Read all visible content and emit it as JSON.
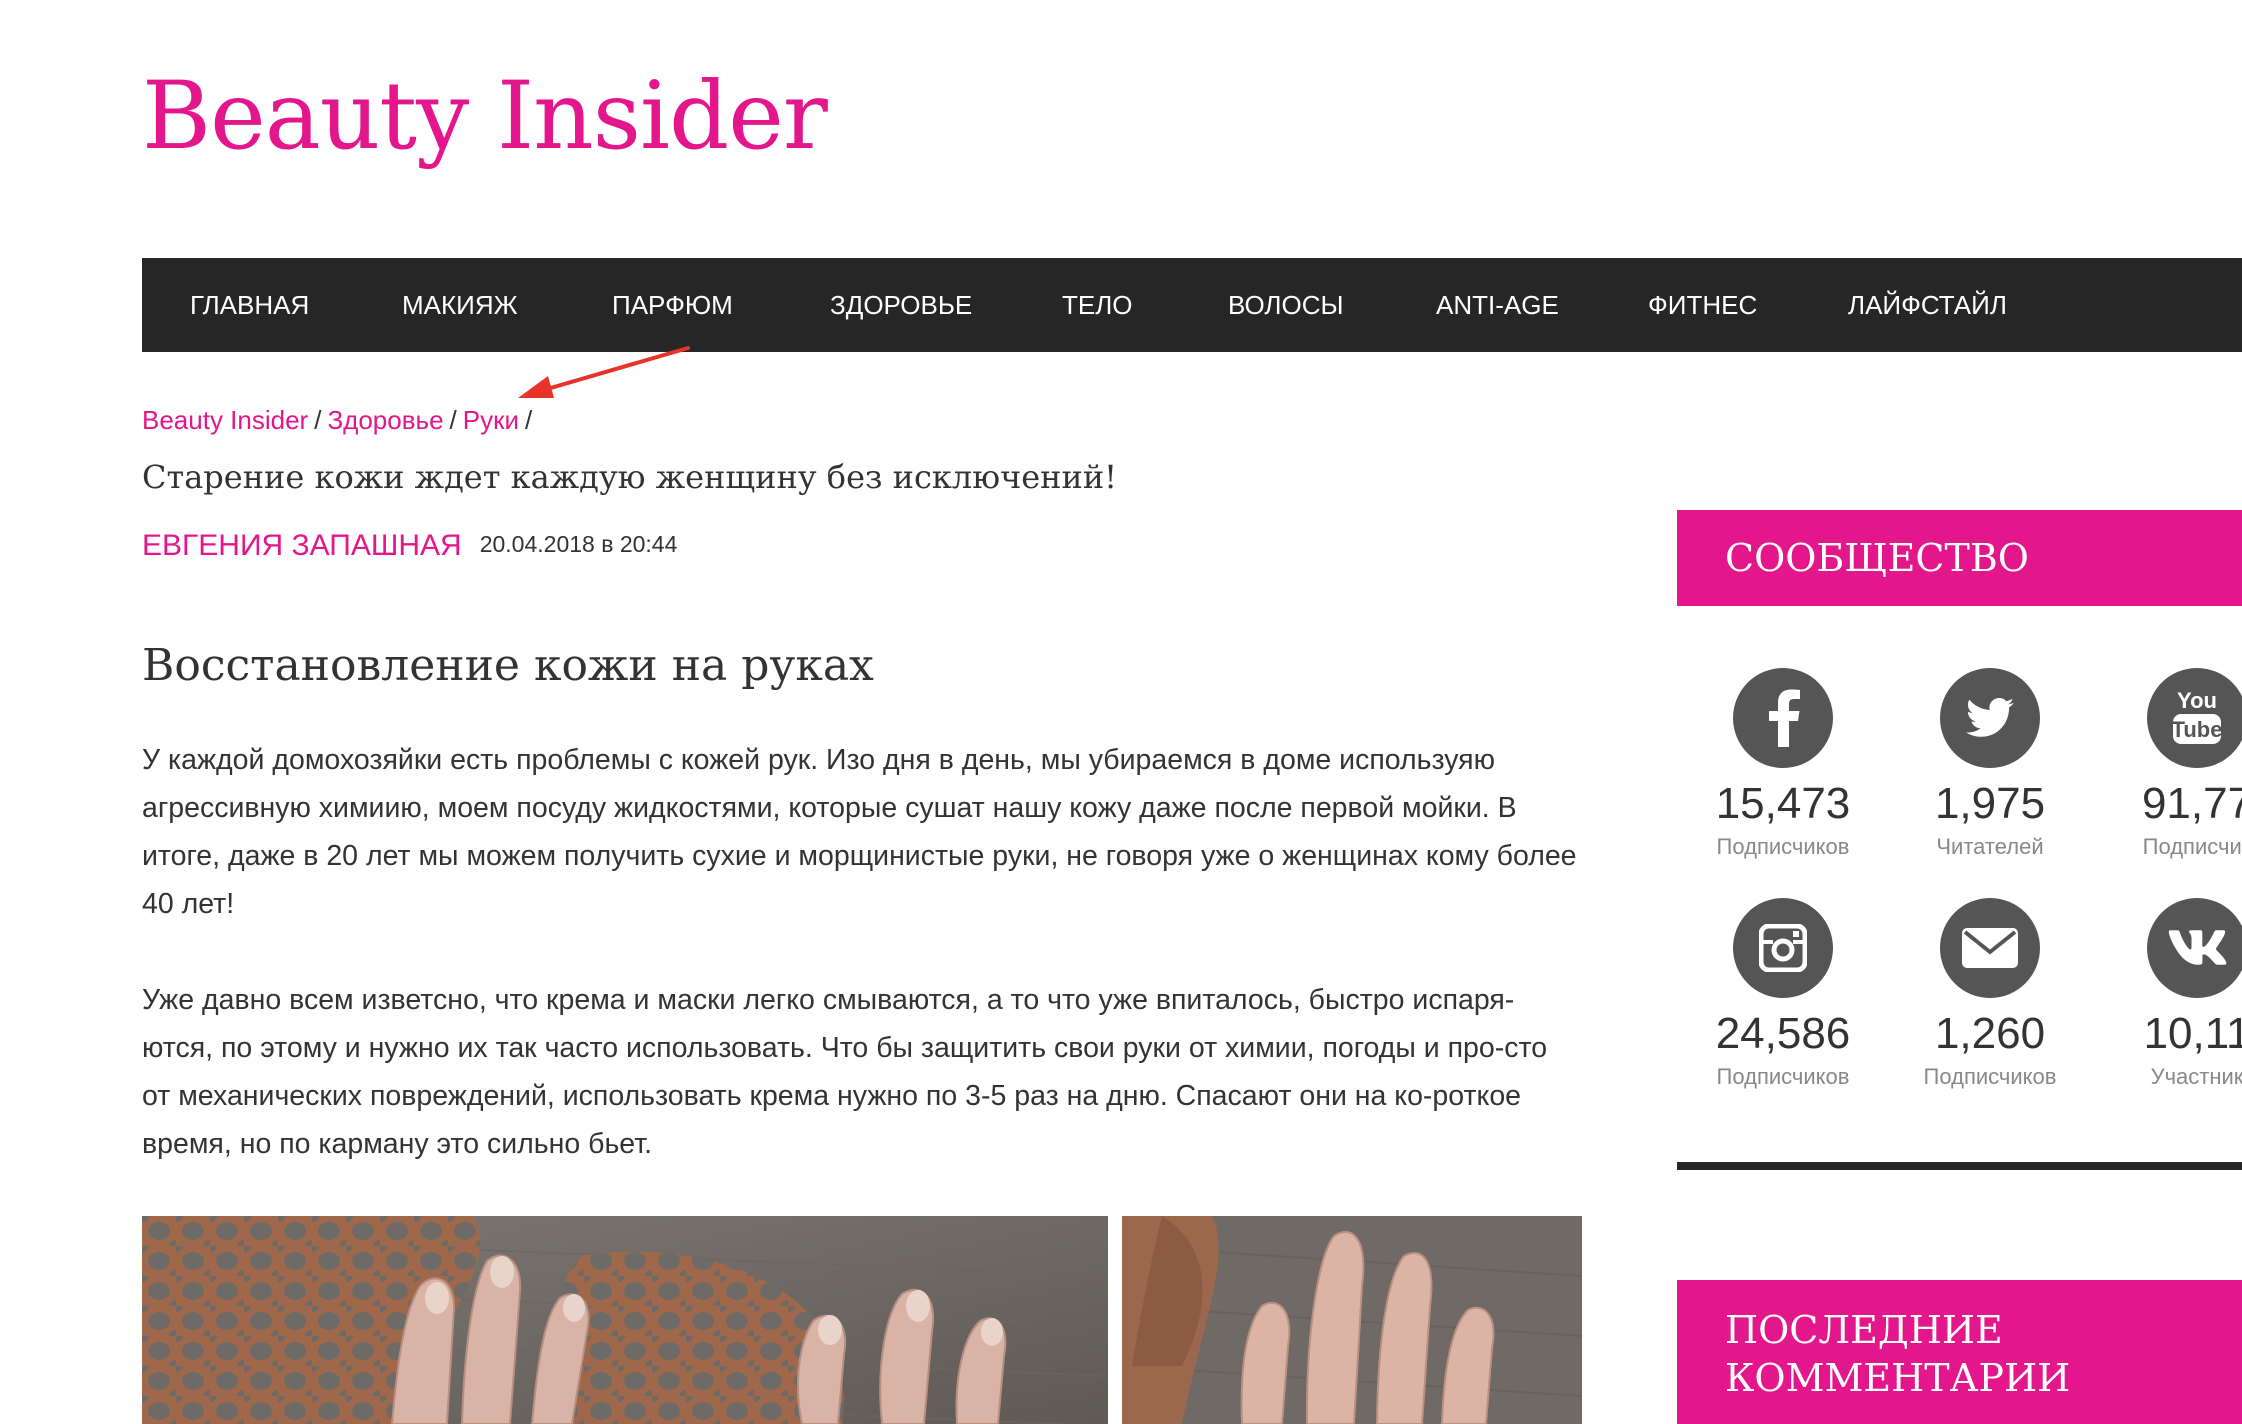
{
  "header": {
    "site_title": "Beauty Insider"
  },
  "nav": {
    "items": [
      "ГЛАВНАЯ",
      "МАКИЯЖ",
      "ПАРФЮМ",
      "ЗДОРОВЬЕ",
      "ТЕЛО",
      "ВОЛОСЫ",
      "ANTI-AGE",
      "ФИТНЕС",
      "ЛАЙФСТАЙЛ"
    ]
  },
  "breadcrumb": {
    "items": [
      "Beauty Insider",
      "Здоровье",
      "Руки"
    ],
    "separator": "/"
  },
  "post": {
    "subtitle": "Старение кожи ждет каждую женщину без исключений!",
    "author": "ЕВГЕНИЯ ЗАПАШНАЯ",
    "date": "20.04.2018 в 20:44",
    "heading": "Восстановление кожи на руках",
    "paragraphs": [
      "У каждой домохозяйки есть проблемы с кожей рук. Изо дня в день, мы убираемся в доме используяю агрессивную химиию, моем посуду жидкостями, которые сушат нашу кожу даже после первой мойки. В итоге, даже в 20 лет мы можем получить сухие и морщинистые руки, не говоря уже о женщинах кому более 40 лет!",
      "Уже давно всем изветсно, что крема и маски легко смываются, а то что уже впиталось, быстро испаря-ются, по этому и нужно их так часто использовать. Что бы защитить свои руки от химии, погоды и про-сто от механических повреждений, использовать крема нужно по 3-5 раз на дню. Спасают они на ко-роткое время, но по карману это сильно бьет."
    ]
  },
  "sidebar": {
    "community_title": "СООБЩЕСТВО",
    "comments_title": "ПОСЛЕДНИЕ КОММЕНТАРИИ",
    "social": [
      {
        "icon": "facebook-icon",
        "count": "15,473",
        "label": "Подписчиков"
      },
      {
        "icon": "twitter-icon",
        "count": "1,975",
        "label": "Читателей"
      },
      {
        "icon": "youtube-icon",
        "count": "91,77",
        "label": "Подписчик"
      },
      {
        "icon": "instagram-icon",
        "count": "24,586",
        "label": "Подписчиков"
      },
      {
        "icon": "email-icon",
        "count": "1,260",
        "label": "Подписчиков"
      },
      {
        "icon": "vk-icon",
        "count": "10,11",
        "label": "Участник"
      }
    ]
  },
  "colors": {
    "accent": "#e3168b",
    "nav_bg": "#262626",
    "icon_bg": "#555555",
    "annotation_arrow": "#e8332a"
  }
}
